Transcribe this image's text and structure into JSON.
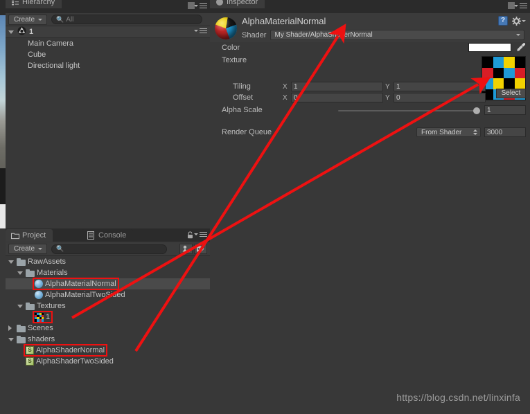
{
  "hierarchy": {
    "tab_label": "Hierarchy",
    "tab_icon": "hierarchy-icon",
    "create_label": "Create",
    "search_placeholder": "All",
    "scene_name": "1",
    "items": [
      {
        "label": "Main Camera"
      },
      {
        "label": "Cube"
      },
      {
        "label": "Directional light"
      }
    ]
  },
  "project": {
    "tabs": [
      {
        "label": "Project",
        "icon": "folder-icon",
        "active": true
      },
      {
        "label": "Console",
        "icon": "console-icon",
        "active": false
      }
    ],
    "create_label": "Create",
    "search_placeholder": "",
    "tree": [
      {
        "label": "RawAssets",
        "type": "folder",
        "depth": 0,
        "expanded": true,
        "selected": false,
        "boxed": false
      },
      {
        "label": "Materials",
        "type": "folder",
        "depth": 1,
        "expanded": true,
        "selected": false,
        "boxed": false
      },
      {
        "label": "AlphaMaterialNormal",
        "type": "material",
        "depth": 2,
        "expanded": null,
        "selected": true,
        "boxed": true
      },
      {
        "label": "AlphaMaterialTwoSided",
        "type": "material",
        "depth": 2,
        "expanded": null,
        "selected": false,
        "boxed": false
      },
      {
        "label": "Textures",
        "type": "folder",
        "depth": 1,
        "expanded": true,
        "selected": false,
        "boxed": false
      },
      {
        "label": "1",
        "type": "texture",
        "depth": 2,
        "expanded": null,
        "selected": false,
        "boxed": true
      },
      {
        "label": "Scenes",
        "type": "folder",
        "depth": 0,
        "expanded": false,
        "selected": false,
        "boxed": false
      },
      {
        "label": "shaders",
        "type": "folder",
        "depth": 0,
        "expanded": true,
        "selected": false,
        "boxed": false
      },
      {
        "label": "AlphaShaderNormal",
        "type": "shader",
        "depth": 1,
        "expanded": null,
        "selected": false,
        "boxed": true
      },
      {
        "label": "AlphaShaderTwoSided",
        "type": "shader",
        "depth": 1,
        "expanded": null,
        "selected": false,
        "boxed": false
      }
    ],
    "shader_glyph": "S"
  },
  "inspector": {
    "tab_label": "Inspector",
    "material_name": "AlphaMaterialNormal",
    "shader_label": "Shader",
    "shader_value": "My Shader/AlphaShaderNormal",
    "help_glyph": "?",
    "properties": {
      "color_label": "Color",
      "color_value": "#ffffff",
      "texture_label": "Texture",
      "texture_select_label": "Select",
      "tiling_label": "Tiling",
      "tiling_x_axis": "X",
      "tiling_x": "1",
      "tiling_y_axis": "Y",
      "tiling_y": "1",
      "offset_label": "Offset",
      "offset_x_axis": "X",
      "offset_x": "0",
      "offset_y_axis": "Y",
      "offset_y": "0",
      "alpha_scale_label": "Alpha Scale",
      "alpha_scale_value": "1",
      "alpha_scale_fraction": 1,
      "render_queue_label": "Render Queue",
      "render_queue_mode": "From Shader",
      "render_queue_value": "3000"
    }
  },
  "texture_swatch": {
    "colors": [
      "#000000",
      "#1e9ad6",
      "#f2d200",
      "#000000",
      "#d81e26",
      "#000000",
      "#1e9ad6",
      "#d81e26",
      "#1e9ad6",
      "#f2d200",
      "#000000",
      "#f2d200",
      "#000000",
      "#1e9ad6",
      "#d81e26",
      "#1e9ad6"
    ]
  },
  "annotation": {
    "color": "#ee1111",
    "watermark": "https://blog.csdn.net/linxinfa"
  }
}
